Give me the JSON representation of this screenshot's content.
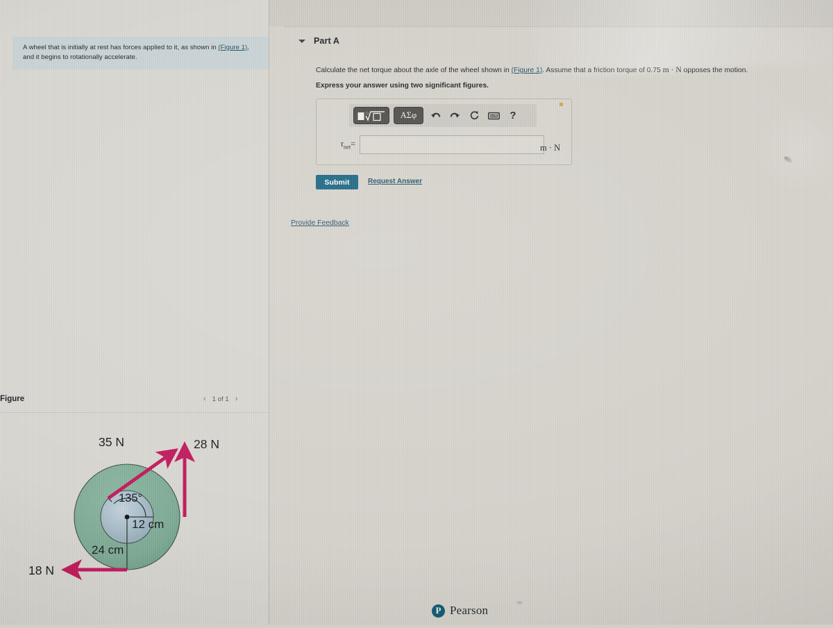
{
  "prompt": {
    "text_before_link": "A wheel that is initially at rest has forces applied to it, as shown in ",
    "link_label": "(Figure 1)",
    "text_after_link": ", and it begins to rotationally accelerate."
  },
  "part": {
    "caret_icon": "caret-down-icon",
    "title": "Part A",
    "question_part1": "Calculate the net torque about the axle of the wheel shown in ",
    "question_link": "(Figure 1)",
    "question_part2": ". Assume that a friction torque of 0.75 ",
    "question_units": "m · N",
    "question_part3": " opposes the motion.",
    "instruction": "Express your answer using two significant figures."
  },
  "answer": {
    "template_button_label": "▣√▫",
    "greek_button_label": "ΑΣφ",
    "undo_icon": "undo-arrow-icon",
    "redo_icon": "redo-arrow-icon",
    "reset_icon": "reset-circular-arrow-icon",
    "keyboard_icon": "keyboard-icon",
    "help_icon": "?",
    "warning_icon": "warning-dot-icon",
    "variable_label": "τ",
    "variable_subscript": "net",
    "equals": "=",
    "input_value": "",
    "input_placeholder": "",
    "units": "m · N"
  },
  "actions": {
    "submit_label": "Submit",
    "request_answer_label": "Request Answer",
    "provide_feedback_label": "Provide Feedback"
  },
  "footer": {
    "brand_mark": "P",
    "brand_name": "Pearson"
  },
  "figure": {
    "title": "Figure",
    "prev_icon": "chevron-left-icon",
    "counter": "1 of 1",
    "next_icon": "chevron-right-icon",
    "colors": {
      "wheel_rim": "#7eab95",
      "wheel_hub": "#a9bdc9",
      "arrow": "#c2185b",
      "outline": "#3c4f46"
    },
    "labels": {
      "force_35": "35 N",
      "force_28": "28 N",
      "force_18": "18 N",
      "angle": "135°",
      "radius_inner": "12 cm",
      "radius_outer": "24 cm"
    }
  },
  "chart_data": {
    "type": "diagram",
    "title": "Wheel with applied forces",
    "wheel": {
      "outer_radius_cm": 24,
      "inner_radius_cm": 12,
      "outer_radius_label": "24 cm",
      "inner_radius_label": "12 cm"
    },
    "forces": [
      {
        "label": "35 N",
        "magnitude_N": 35,
        "applied_at_radius_cm": 12,
        "direction_deg_from_inner_radius": 135,
        "description": "tangent-ish force applied at inner hub edge, pointing up-right at 45° above horizontal"
      },
      {
        "label": "28 N",
        "magnitude_N": 28,
        "applied_at_radius_cm": 24,
        "direction_deg": 90,
        "description": "vertical upward force applied at right edge of outer rim"
      },
      {
        "label": "18 N",
        "magnitude_N": 18,
        "applied_at_radius_cm": 24,
        "direction_deg": 180,
        "description": "horizontal leftward force applied at bottom of outer rim"
      }
    ],
    "angles": [
      {
        "label": "135°",
        "value_deg": 135,
        "between": [
          "12 cm radius (horizontal right)",
          "35 N force line"
        ]
      }
    ],
    "friction_torque_m_N": 0.75
  }
}
